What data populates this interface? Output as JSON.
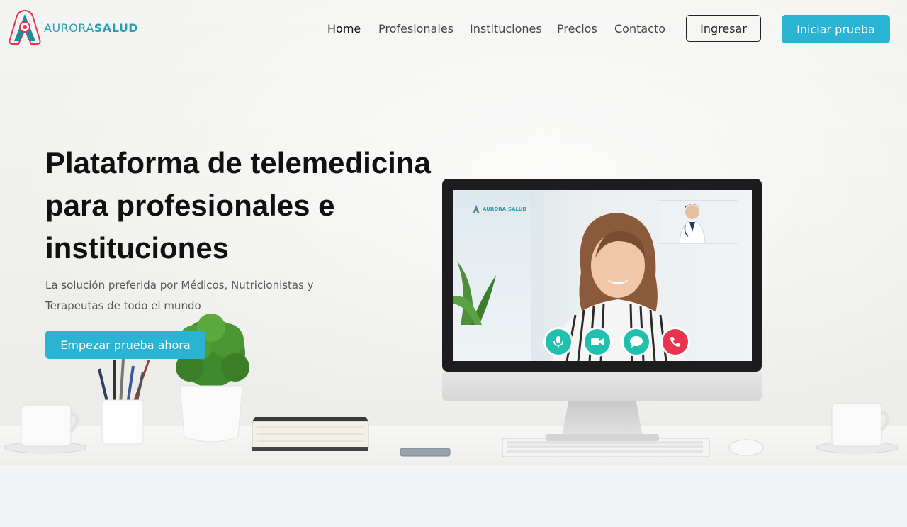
{
  "brand": {
    "name_light": "AURORA",
    "name_bold": "SALUD",
    "accent": "#2bb3d4"
  },
  "nav": {
    "links": [
      {
        "label": "Home",
        "active": true
      },
      {
        "label": "Profesionales",
        "active": false
      },
      {
        "label": "Instituciones",
        "active": false
      },
      {
        "label": "Precios",
        "active": false
      },
      {
        "label": "Contacto",
        "active": false
      }
    ],
    "login_label": "Ingresar",
    "trial_label": "Iniciar prueba"
  },
  "hero": {
    "title_line1": "Plataforma de telemedicina",
    "title_line2": "para profesionales e",
    "title_line3": "instituciones",
    "subtitle_line1": "La solución preferida por Médicos, Nutricionistas y",
    "subtitle_line2": "Terapeutas de todo el mundo",
    "cta_label": "Empezar prueba ahora"
  },
  "screen": {
    "logo_light": "AURORA",
    "logo_bold": "SALUD",
    "controls": [
      "microphone-icon",
      "video-camera-icon",
      "chat-icon",
      "hang-up-phone-icon"
    ]
  }
}
